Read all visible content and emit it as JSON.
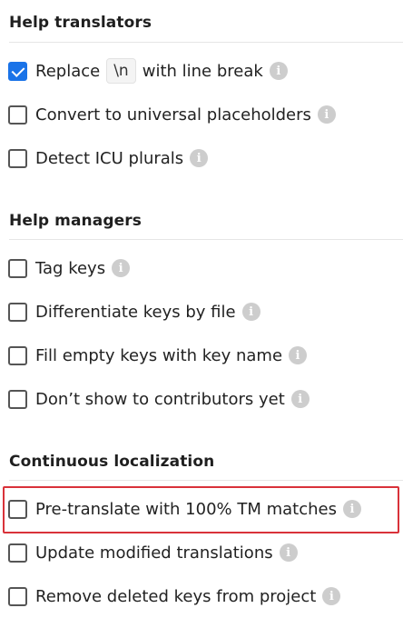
{
  "sections": [
    {
      "title": "Help translators",
      "options": [
        {
          "label_before": "Replace",
          "code": "\\n",
          "label_after": "with line break",
          "checked": true
        },
        {
          "label": "Convert to universal placeholders",
          "checked": false
        },
        {
          "label": "Detect ICU plurals",
          "checked": false
        }
      ]
    },
    {
      "title": "Help managers",
      "options": [
        {
          "label": "Tag keys",
          "checked": false
        },
        {
          "label": "Differentiate keys by file",
          "checked": false
        },
        {
          "label": "Fill empty keys with key name",
          "checked": false
        },
        {
          "label": "Don’t show to contributors yet",
          "checked": false
        }
      ]
    },
    {
      "title": "Continuous localization",
      "options": [
        {
          "label": "Pre-translate with 100% TM matches",
          "checked": false,
          "highlighted": true
        },
        {
          "label": "Update modified translations",
          "checked": false
        },
        {
          "label": "Remove deleted keys from project",
          "checked": false
        }
      ]
    }
  ],
  "info_glyph": "i",
  "colors": {
    "accent": "#1a73e8",
    "highlight": "#d9323a",
    "info_icon": "#cdcdcd"
  }
}
